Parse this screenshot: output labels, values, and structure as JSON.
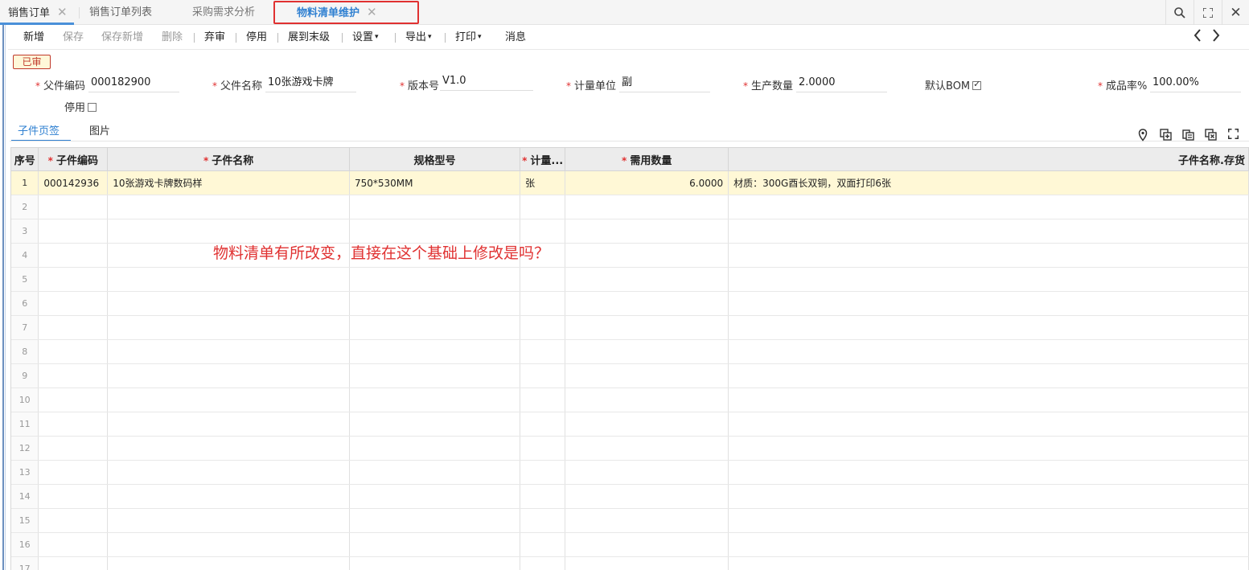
{
  "tabs": [
    {
      "label": "销售订单",
      "closable": true
    },
    {
      "label": "销售订单列表",
      "closable": false
    },
    {
      "label": "采购需求分析",
      "closable": false
    },
    {
      "label": "物料清单维护",
      "closable": true,
      "active": true
    }
  ],
  "toolbar": {
    "add": "新增",
    "save": "保存",
    "save_new": "保存新增",
    "delete": "删除",
    "unapprove": "弃审",
    "disable": "停用",
    "expand": "展到末级",
    "settings": "设置",
    "export": "导出",
    "print": "打印",
    "message": "消息",
    "prev": "‹",
    "next": "›"
  },
  "status_badge": "已审",
  "form": {
    "parent_code_label": "父件编码",
    "parent_code": "000182900",
    "parent_name_label": "父件名称",
    "parent_name": "10张游戏卡牌",
    "version_label": "版本号",
    "version": "V1.0",
    "unit_label": "计量单位",
    "unit": "副",
    "qty_label": "生产数量",
    "qty": "2.0000",
    "default_bom_label": "默认BOM",
    "default_bom": true,
    "yield_label": "成品率%",
    "yield": "100.00%",
    "disabled_label": "停用",
    "disabled": false
  },
  "subtabs": {
    "children": "子件页签",
    "image": "图片"
  },
  "table": {
    "headers": [
      "序号",
      "子件编码",
      "子件名称",
      "规格型号",
      "计量...",
      "需用数量",
      "子件名称.存货"
    ],
    "required": [
      false,
      true,
      true,
      false,
      true,
      true,
      false
    ],
    "rows": [
      [
        "1",
        "000142936",
        "10张游戏卡牌数码样",
        "750*530MM",
        "张",
        "6.0000",
        "材质：300G酉长双铜，双面打印6张"
      ]
    ],
    "empty_row_numbers": [
      "2",
      "3",
      "4",
      "5",
      "6",
      "7",
      "8",
      "9",
      "10",
      "11",
      "12",
      "13",
      "14",
      "15",
      "16",
      "17"
    ]
  },
  "annotation": "物料清单有所改变，直接在这个基础上修改是吗？",
  "colors": {
    "accent": "#2f80d1",
    "highlight": "#e03131",
    "selected_row": "#fff8d6"
  }
}
